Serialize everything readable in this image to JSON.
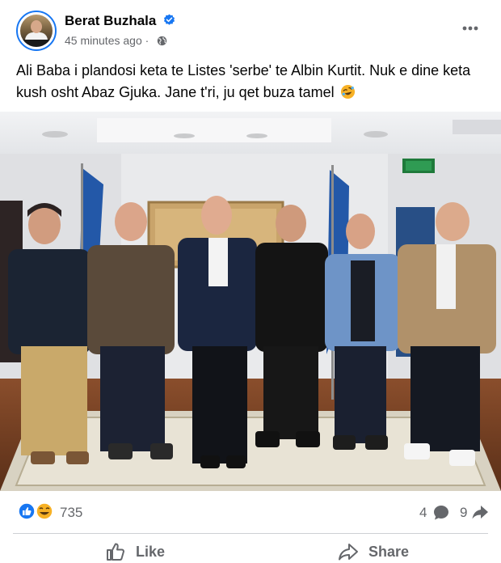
{
  "post": {
    "author": "Berat Buzhala",
    "time": "45 minutes ago",
    "text": "Ali Baba i plandosi keta te Listes 'serbe' te Albin Kurtit. Nuk e dine keta kush osht Abaz Gjuka. Jane t'ri, ju qet buza tamel",
    "text_emoji": "rolling-on-floor-laughing-emoji"
  },
  "stats": {
    "reactions_count": "735",
    "comments_count": "4",
    "shares_count": "9",
    "reaction_icons": [
      "like-icon",
      "laugh-emoji-icon"
    ]
  },
  "actions": {
    "like_label": "Like",
    "share_label": "Share"
  },
  "colors": {
    "brand_blue": "#1877f2",
    "secondary_text": "#65676b",
    "divider": "#ced0d4"
  }
}
